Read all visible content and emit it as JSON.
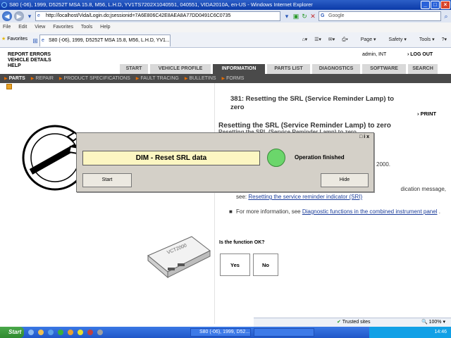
{
  "window": {
    "title": "S80 (-06), 1999, D5252T MSA 15.8, M56, L.H.D, YV1TS7202X1040551, 040551, VIDA2010A, en-US - Windows Internet Explorer"
  },
  "address": {
    "url": "http://localhost/Vida/Login.do;jsessionid=7A6E806C42E8AEA8A77DD0491C6C0735",
    "search_placeholder": "Google"
  },
  "menu": [
    "File",
    "Edit",
    "View",
    "Favorites",
    "Tools",
    "Help"
  ],
  "favorites": {
    "label": "Favorites",
    "tab_title": "S80 (-06), 1999, D5252T MSA 15.8, M56, L.H.D, YV1...",
    "page_cmds": [
      "Page",
      "Safety",
      "Tools"
    ]
  },
  "page": {
    "links": [
      "REPORT ERRORS",
      "VEHICLE DETAILS",
      "HELP"
    ],
    "user": "admin, INT",
    "logout": "LOG OUT",
    "tabs": [
      "START",
      "VEHICLE PROFILE",
      "INFORMATION",
      "PARTS LIST",
      "DIAGNOSTICS",
      "SOFTWARE",
      "SEARCH"
    ],
    "active_tab": "INFORMATION",
    "subnav": [
      "PARTS",
      "REPAIR",
      "PRODUCT SPECIFICATIONS",
      "FAULT TRACING",
      "BULLETINS",
      "FORMS"
    ],
    "doc_title": "381: Resetting the SRL (Service Reminder Lamp) to zero",
    "print": "PRINT",
    "section_title": "Resetting the SRL (Service Reminder Lamp) to zero",
    "section_subtitle": "Resetting the SRL (Service Reminder Lamp) to zero",
    "year_text": "2000.",
    "para1_text": "dication message,",
    "para1_prefix": "see: ",
    "para1_link": "Resetting the service reminder indicator (SRI)",
    "para2_prefix": "For more information, see ",
    "para2_link": "Diagnostic functions in the combined instrument panel",
    "para2_suffix": " .",
    "question": "Is the function OK?",
    "yes": "Yes",
    "no": "No",
    "device_label": "VCT2000"
  },
  "dialog": {
    "controls": "□ i x",
    "field": "DIM - Reset SRL data",
    "status": "Operation finished",
    "lamp_color": "#6bd66b",
    "start_btn": "Start",
    "hide_btn": "Hide"
  },
  "statusbar": {
    "zone": "Trusted sites",
    "zoom": "100%"
  },
  "taskbar": {
    "start": "Start",
    "task1": "S80 (-06), 1999, D52...",
    "clock": "14:46"
  }
}
